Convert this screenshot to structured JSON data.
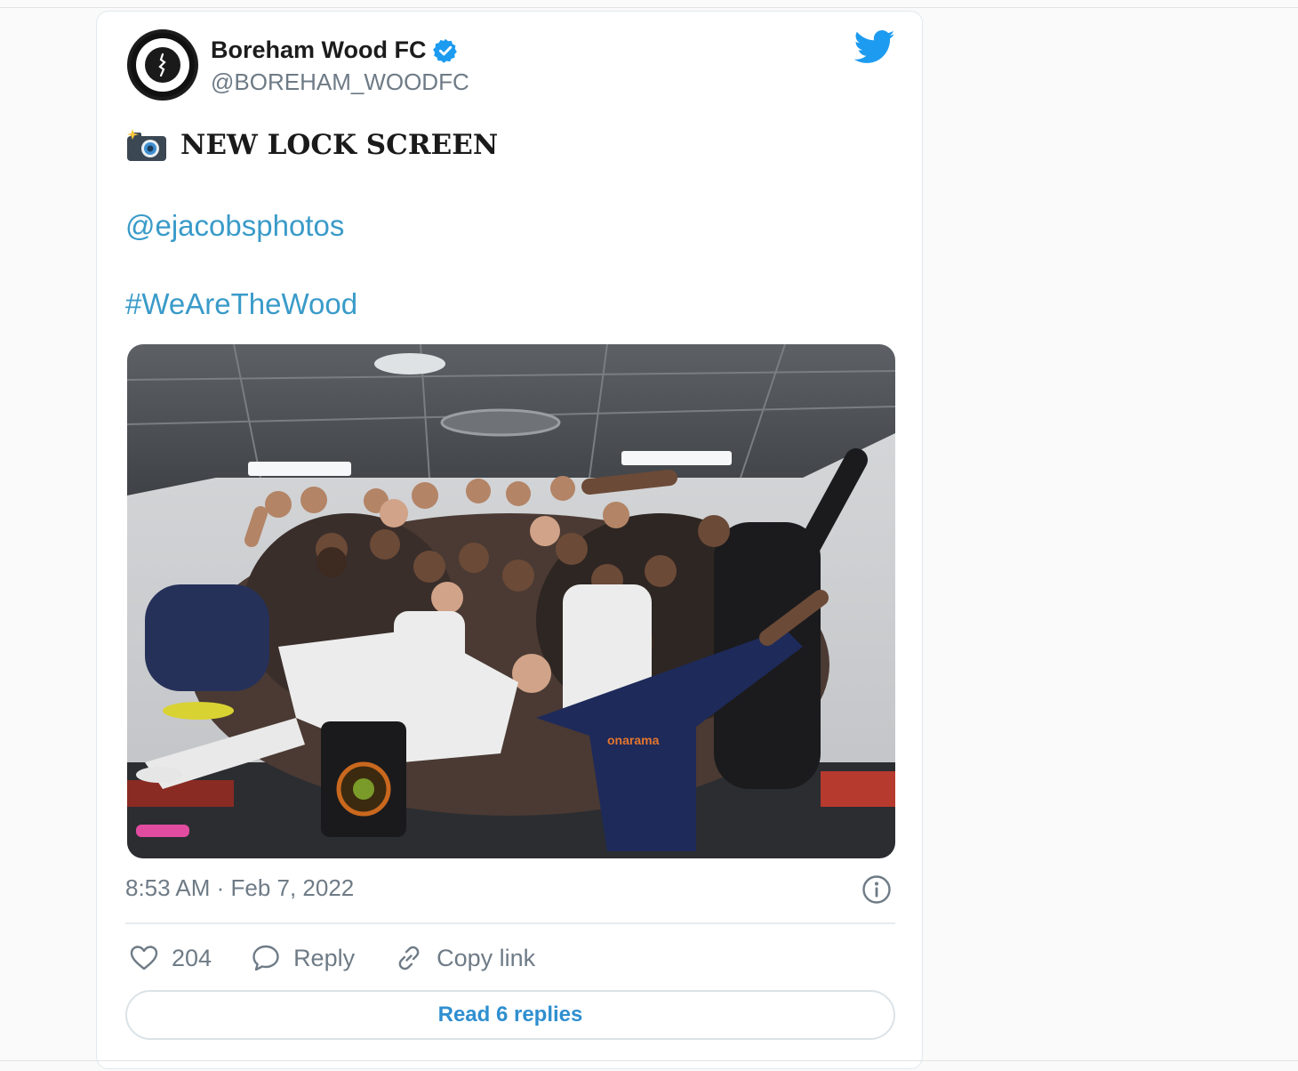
{
  "author": {
    "name": "Boreham Wood FC",
    "handle": "@BOREHAM_WOODFC"
  },
  "tweet": {
    "headline": "NEW LOCK SCREEN",
    "mention": "@ejacobsphotos",
    "hashtag": "#WeAreTheWood",
    "timestamp": "8:53 AM · Feb 7, 2022"
  },
  "actions": {
    "like_count": "204",
    "reply_label": "Reply",
    "copy_link_label": "Copy link",
    "read_replies_label": "Read 6 replies"
  },
  "icons": {
    "camera": "camera-flash-icon",
    "bird": "twitter-bird-icon",
    "verified": "verified-badge-icon",
    "heart": "heart-icon",
    "reply": "speech-bubble-icon",
    "link": "link-icon",
    "info": "info-icon"
  },
  "colors": {
    "link": "#3a9bc9",
    "twitter_blue": "#1d9bf0",
    "muted": "#6e7b86",
    "read_replies": "#2f8fd0"
  }
}
